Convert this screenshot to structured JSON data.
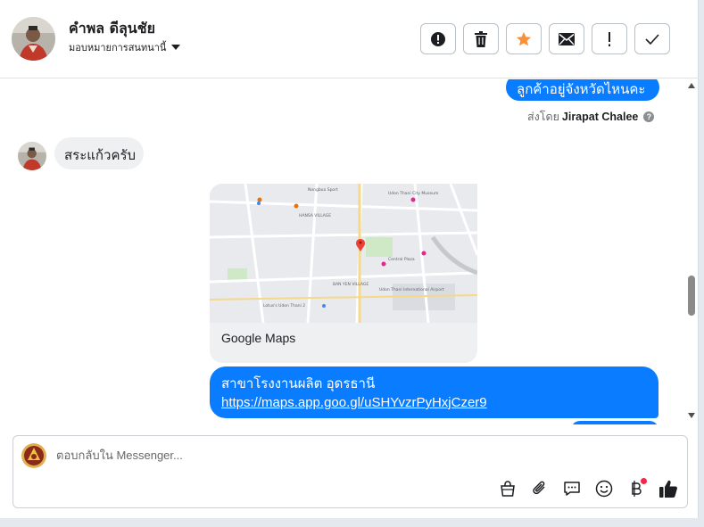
{
  "header": {
    "contact_name": "คำพล ดีลุนชัย",
    "assign_label": "มอบหมายการสนทนานี้",
    "actions": [
      {
        "name": "mark-spam",
        "icon": "alert-circle-icon"
      },
      {
        "name": "delete",
        "icon": "trash-icon"
      },
      {
        "name": "star",
        "icon": "star-icon",
        "color": "#f7923a"
      },
      {
        "name": "mark-unread",
        "icon": "envelope-icon"
      },
      {
        "name": "follow-up",
        "icon": "exclamation-icon"
      },
      {
        "name": "done",
        "icon": "check-icon"
      }
    ]
  },
  "messages": {
    "out_1": "ลูกค้าอยู่จังหวัดไหนคะ",
    "sent_by_prefix": "ส่งโดย",
    "sent_by_name": "Jirapat Chalee",
    "in_1": "สระแก้วครับ",
    "map_card_title": "Google Maps",
    "out_2_line1": "สาขาโรงงานผลิต อุดรธานี",
    "out_2_link": "https://maps.app.goo.gl/uSHYvzrPyHxjCzer9"
  },
  "map_labels": {
    "place_1": "Nongbua Sport",
    "place_2": "Udon Thani City Museum",
    "place_3": "HANSA VILLAGE",
    "place_4": "Central Plaza",
    "place_5": "Udon Thani International Airport",
    "place_6": "BAN YEN VILLAGE",
    "place_7": "Lotus's Udon Thani 2"
  },
  "composer": {
    "placeholder": "ตอบกลับใน Messenger...",
    "tools": [
      "shopping-bag-icon",
      "paperclip-icon",
      "saved-replies-icon",
      "emoji-icon",
      "baht-icon",
      "like-icon"
    ]
  },
  "colors": {
    "outgoing_bubble": "#0a7cff",
    "incoming_bubble": "#eff0f2",
    "star_accent": "#f7923a"
  }
}
